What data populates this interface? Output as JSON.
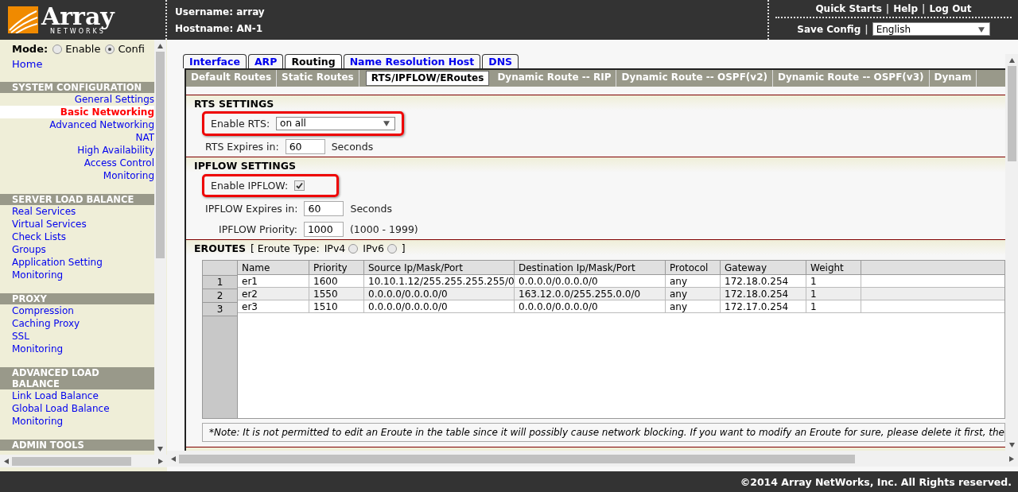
{
  "header": {
    "logo": {
      "word": "Array",
      "tagline": "NETWORKS"
    },
    "username": "Username: array",
    "hostname": "Hostname: AN-1",
    "top_links": [
      {
        "kind": "link",
        "label": "Quick Starts"
      },
      {
        "kind": "separator",
        "label": "|"
      },
      {
        "kind": "link",
        "label": "Help"
      },
      {
        "kind": "separator",
        "label": "|"
      },
      {
        "kind": "link",
        "label": "Log Out"
      }
    ],
    "save_config": "Save Config",
    "save_separator": "|",
    "language": "English"
  },
  "sidebar": {
    "mode": {
      "label": "Mode:",
      "options": [
        {
          "label": "Enable",
          "selected": false
        },
        {
          "label": "Confi",
          "selected": true
        }
      ]
    },
    "home": "Home",
    "sections": [
      {
        "title": "SYSTEM CONFIGURATION",
        "kind": "submenu",
        "items": [
          {
            "label": "General Settings",
            "selected": false
          },
          {
            "label": "Basic Networking",
            "selected": true
          },
          {
            "label": "Advanced Networking",
            "selected": false
          },
          {
            "label": "NAT",
            "selected": false
          },
          {
            "label": "High Availability",
            "selected": false
          },
          {
            "label": "Access Control",
            "selected": false
          },
          {
            "label": "Monitoring",
            "selected": false
          }
        ]
      },
      {
        "title": "SERVER LOAD BALANCE",
        "kind": "menu",
        "items": [
          {
            "label": "Real Services",
            "selected": false
          },
          {
            "label": "Virtual Services",
            "selected": false
          },
          {
            "label": "Check Lists",
            "selected": false
          },
          {
            "label": "Groups",
            "selected": false
          },
          {
            "label": "Application Setting",
            "selected": false
          },
          {
            "label": "Monitoring",
            "selected": false
          }
        ]
      },
      {
        "title": "PROXY",
        "kind": "menu",
        "items": [
          {
            "label": "Compression",
            "selected": false
          },
          {
            "label": "Caching Proxy",
            "selected": false
          },
          {
            "label": "SSL",
            "selected": false
          },
          {
            "label": "Monitoring",
            "selected": false
          }
        ]
      },
      {
        "title": "ADVANCED LOAD BALANCE",
        "kind": "menu",
        "items": [
          {
            "label": "Link Load Balance",
            "selected": false
          },
          {
            "label": "Global Load Balance",
            "selected": false
          },
          {
            "label": "Monitoring",
            "selected": false
          }
        ]
      },
      {
        "title": "ADMIN TOOLS"
      }
    ]
  },
  "tabs": [
    {
      "label": "Interface",
      "selected": false
    },
    {
      "label": "ARP",
      "selected": false
    },
    {
      "label": "Routing",
      "selected": true
    },
    {
      "label": "Name Resolution Host",
      "selected": false
    },
    {
      "label": "DNS",
      "selected": false
    }
  ],
  "subtabs": [
    {
      "label": "Default Routes",
      "selected": false
    },
    {
      "label": "Static Routes",
      "selected": false
    },
    {
      "label": "RTS/IPFLOW/ERoutes",
      "selected": true
    },
    {
      "label": "Dynamic Route -- RIP",
      "selected": false
    },
    {
      "label": "Dynamic Route -- OSPF(v2)",
      "selected": false
    },
    {
      "label": "Dynamic Route -- OSPF(v3)",
      "selected": false
    },
    {
      "label": "Dynam",
      "selected": false
    }
  ],
  "rts": {
    "title": "RTS SETTINGS",
    "enable": {
      "label": "Enable RTS:",
      "value": "on all",
      "highlighted": true
    },
    "expires": {
      "label": "RTS Expires in:",
      "value": "60",
      "unit": "Seconds"
    }
  },
  "ipflow": {
    "title": "IPFLOW SETTINGS",
    "enable": {
      "label": "Enable IPFLOW:",
      "checked": true,
      "highlighted": true
    },
    "expires": {
      "label": "IPFLOW Expires in:",
      "value": "60",
      "unit": "Seconds"
    },
    "priority": {
      "label": "IPFLOW Priority:",
      "value": "1000",
      "range": "(1000 - 1999)"
    }
  },
  "eroutes": {
    "title": "EROUTES",
    "type_open": "[ Eroute Type:",
    "type_options": [
      {
        "label": "IPv4",
        "selected": false
      },
      {
        "label": "IPv6",
        "selected": false
      }
    ],
    "type_close": "]",
    "columns": [
      "Name",
      "Priority",
      "Source Ip/Mask/Port",
      "Destination Ip/Mask/Port",
      "Protocol",
      "Gateway",
      "Weight"
    ],
    "rows": [
      {
        "number": "1",
        "cells": [
          "er1",
          "1600",
          "10.10.1.12/255.255.255.255/0",
          "0.0.0.0/0.0.0.0/0",
          "any",
          "172.18.0.254",
          "1"
        ]
      },
      {
        "number": "2",
        "cells": [
          "er2",
          "1550",
          "0.0.0.0/0.0.0.0/0",
          "163.12.0.0/255.255.0.0/0",
          "any",
          "172.18.0.254",
          "1"
        ]
      },
      {
        "number": "3",
        "cells": [
          "er3",
          "1510",
          "0.0.0.0/0.0.0.0/0",
          "0.0.0.0/0.0.0.0/0",
          "any",
          "172.17.0.254",
          "1"
        ]
      }
    ],
    "note": "*Note: It is not permitted to edit an Eroute in the table since it will possibly cause network blocking. If you want to modify an Eroute for sure, please delete it first, the"
  },
  "footer": "©2014 Array NetWorks, Inc. All Rights reserved."
}
